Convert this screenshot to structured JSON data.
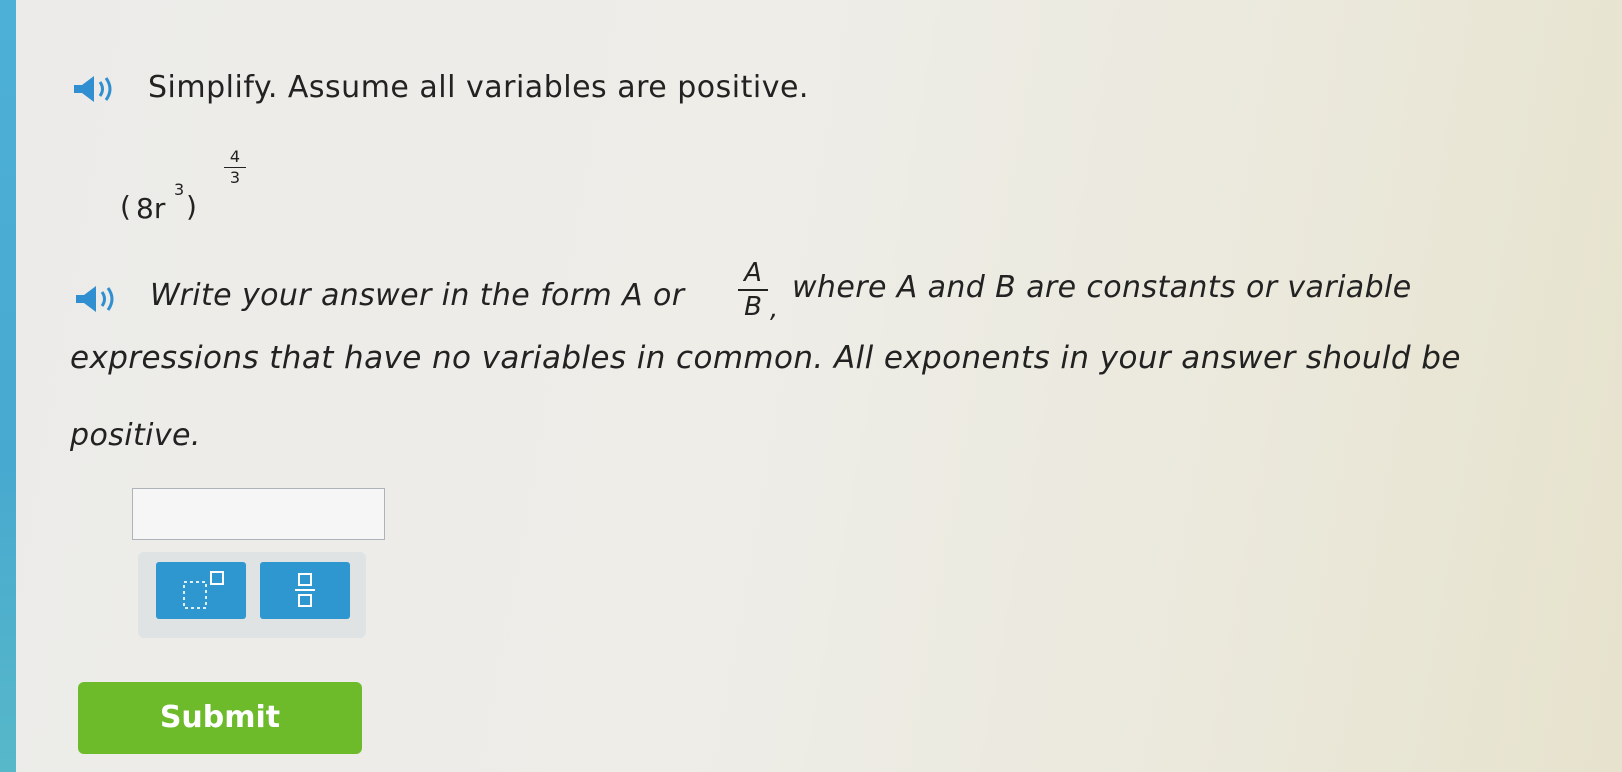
{
  "question": {
    "prompt": "Simplify. Assume all variables are positive.",
    "expression": {
      "open_paren": "(",
      "base": "8r",
      "inner_exponent": "3",
      "close_paren": ")",
      "outer_exponent_numerator": "4",
      "outer_exponent_denominator": "3"
    }
  },
  "instructions": {
    "part1": "Write your answer in the form A or",
    "fraction_numerator": "A",
    "fraction_denominator": "B",
    "fraction_suffix": ",",
    "part2": "where A and B are constants or variable",
    "line2": "expressions that have no variables in common. All exponents in your answer should be",
    "line3": "positive."
  },
  "answer": {
    "value": ""
  },
  "toolbar": {
    "buttons": [
      "superscript-button",
      "fraction-button"
    ]
  },
  "submit": {
    "label": "Submit"
  },
  "colors": {
    "left_bar": "#4db0d6",
    "speaker_icon": "#2f8fd0",
    "tool_button": "#2f97cf",
    "submit_button": "#6dbb2a"
  }
}
